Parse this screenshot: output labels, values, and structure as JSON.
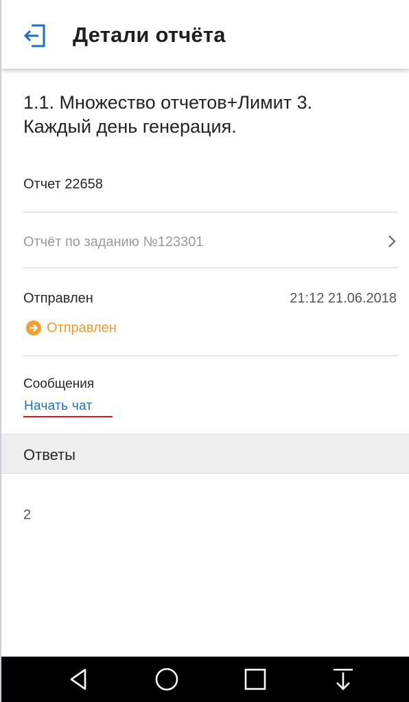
{
  "header": {
    "title": "Детали отчёта",
    "back_icon": "exit-to-left-icon",
    "accent_color": "#1c6fc7"
  },
  "report": {
    "title_lines": [
      "1.1. Множество отчетов+Лимит 3.",
      "Каждый день генерация."
    ],
    "number": "Отчет 22658",
    "task_link": "Отчёт по заданию №123301"
  },
  "status": {
    "label": "Отправлен",
    "datetime": "21:12 21.06.2018",
    "badge_text": "Отправлен",
    "badge_color": "#f0a030"
  },
  "messages": {
    "label": "Сообщения",
    "chat_link": "Начать чат"
  },
  "answers": {
    "section_title": "Ответы",
    "value": "2"
  },
  "navbar": {
    "buttons": [
      "back-triangle-icon",
      "home-circle-icon",
      "recents-square-icon",
      "download-arrow-icon"
    ]
  }
}
